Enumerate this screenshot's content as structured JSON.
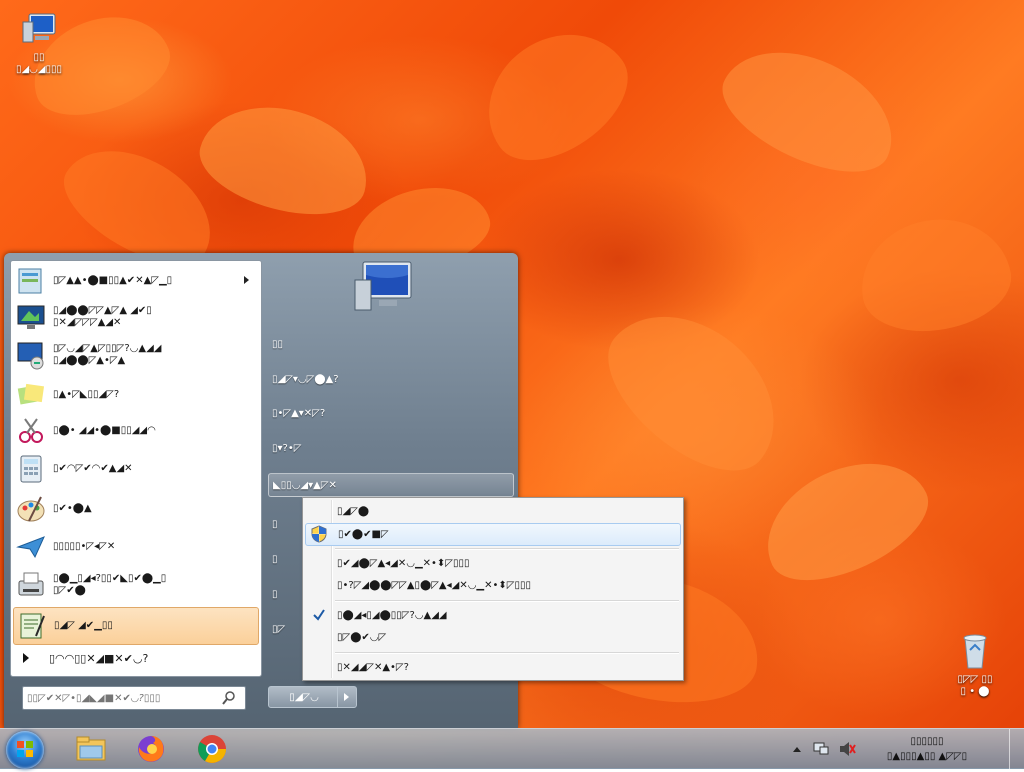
{
  "desktop": {
    "icons": [
      {
        "name": "Computer",
        "label_line1": "▯▯",
        "label_line2": "▯◢◡◢▯▯▯"
      },
      {
        "name": "Recycle Bin",
        "label_line1": "▯◸◸ ▯▯",
        "label_line2": "▯ • ⬤"
      }
    ]
  },
  "start_menu": {
    "programs": [
      {
        "label": "▯◸▲▲•⬤■▯▯▲✔✕▲◸▁▯",
        "label2": "",
        "icon": "getting-started-icon",
        "has_submenu": true
      },
      {
        "label": "▯◢⬤⬤◸◸▲◸▲ ◢✔▯",
        "label2": "▯✕◢◸◸◸▲◢✕",
        "icon": "windows-media-center-icon",
        "has_submenu": false
      },
      {
        "label": "▯◸◡◢◸▲◸▯▯◸?◡▲◢◢",
        "label2": "▯◢⬤⬤◸▲•◸▲",
        "icon": "remote-desktop-icon",
        "has_submenu": false
      },
      {
        "label": "▯▲•◸◣▯▯◢◸?",
        "label2": "",
        "icon": "sticky-notes-icon",
        "has_submenu": false
      },
      {
        "label": "▯⬤• ◢◢•⬤■▯▯◢◢◠",
        "label2": "",
        "icon": "snipping-tool-icon",
        "has_submenu": false
      },
      {
        "label": "▯✔◠◸✔◠✔▲◢✕",
        "label2": "",
        "icon": "calculator-icon",
        "has_submenu": false
      },
      {
        "label": "▯✔•⬤▲",
        "label2": "",
        "icon": "paint-icon",
        "has_submenu": false
      },
      {
        "label": "▯▯▯▯▯•◸◂◸✕",
        "label2": "",
        "icon": "mail-send-icon",
        "has_submenu": false
      },
      {
        "label": "▯⬤▁▯◢◂?▯▯✔◣▯✔⬤▁▯",
        "label2": "▯◸✔⬤",
        "icon": "fax-scan-icon",
        "has_submenu": false
      },
      {
        "label": "▯◢◸ ◢✔▁▯▯",
        "label2": "",
        "icon": "notepad-icon",
        "has_submenu": false
      }
    ],
    "all_programs": "▯◠◠▯▯✕◢■✕✔◡?",
    "search_placeholder": "▯▯◸✔✕◸•▯◢◣◢■✕✔◡?▯▯▯",
    "right_items": [
      "▯▯",
      "▯◢◸▾◡◸⬤▲?",
      "▯•◸▲▾✕◸?",
      "▯▾?•◸",
      "◣▯▯◡◢▾▲◸✕",
      "▯",
      "▯",
      "▯",
      "▯◸"
    ],
    "shutdown_label": "▯◢◸◡"
  },
  "context_menu": {
    "items": [
      {
        "label": "▯◢◸⬤",
        "icon": "",
        "checked": false,
        "hover": false
      },
      {
        "label": "▯✔⬤✔■◸",
        "icon": "uac-shield-icon",
        "checked": false,
        "hover": true
      },
      {
        "label": "▯✔◢⬤◸▲◂◢✕◡▁✕•⬍◸▯▯▯",
        "icon": "",
        "checked": false,
        "hover": false
      },
      {
        "label": "▯•?◸◢⬤⬤◸◸▲▯⬤◸▲◂◢✕◡▁✕•⬍◸▯▯▯",
        "icon": "",
        "checked": false,
        "hover": false
      },
      {
        "label": "▯⬤◢◂▯◢⬤▯▯◸?◡▲◢◢",
        "icon": "",
        "checked": true,
        "hover": false
      },
      {
        "label": "▯◸⬤✔◡◸",
        "icon": "",
        "checked": false,
        "hover": false
      },
      {
        "label": "▯✕◢◢◸✕▲•◸?",
        "icon": "",
        "checked": false,
        "hover": false
      }
    ]
  },
  "taskbar": {
    "apps": [
      "explorer-icon",
      "firefox-icon",
      "chrome-icon"
    ],
    "clock_line1": "▯▯▯▯▯▯",
    "clock_line2": "▯▲▯▯▯▲▯▯ ▲◸◸▯"
  },
  "colors": {
    "wallpaper": "#f05a0e",
    "menu_highlight": "#fbd09a",
    "hover_blue": "#dcebfb"
  }
}
